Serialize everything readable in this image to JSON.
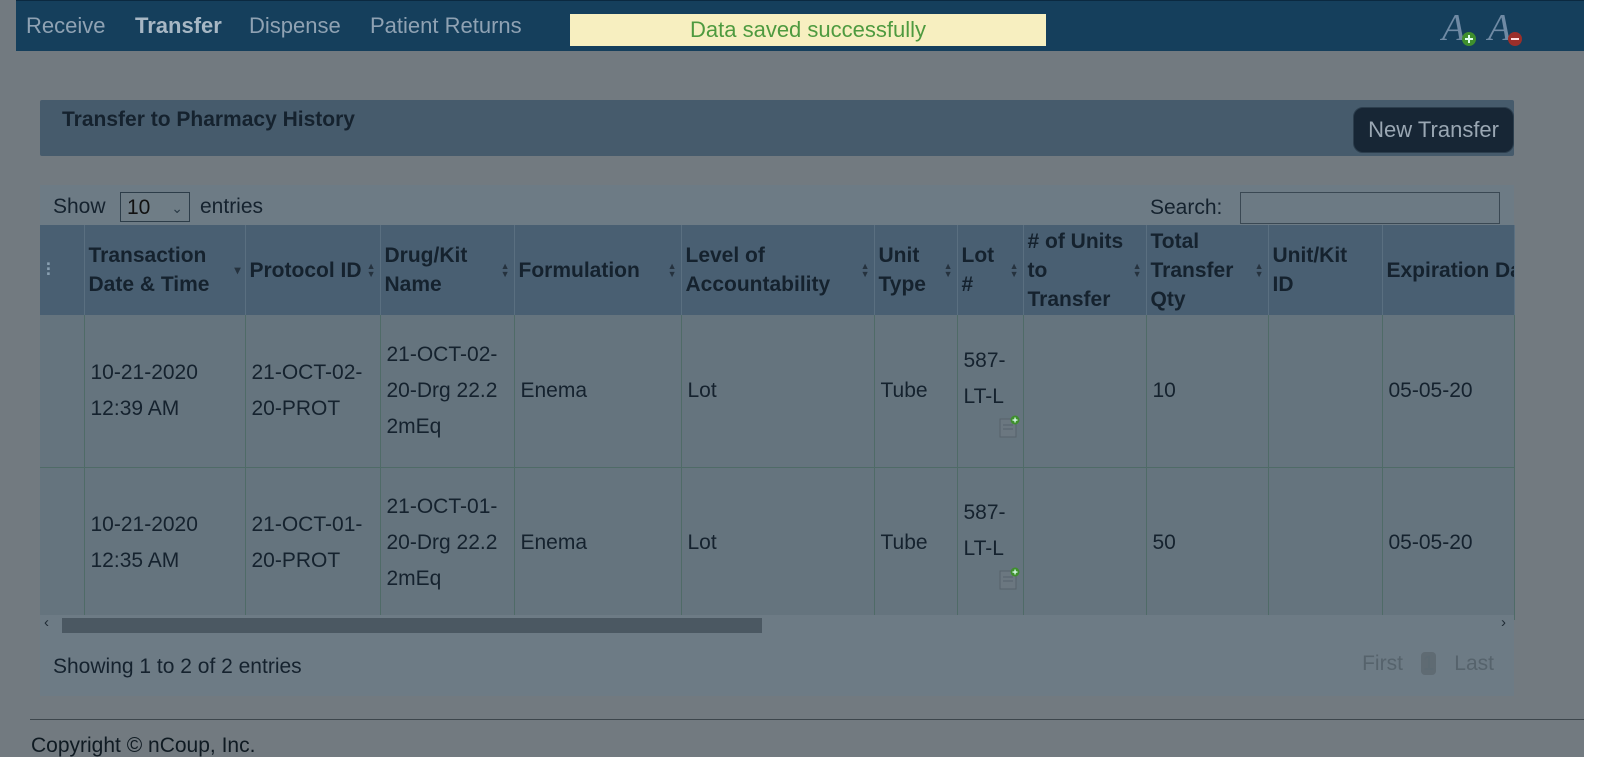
{
  "nav": {
    "items": [
      "Receive",
      "Transfer",
      "Dispense",
      "Patient Returns"
    ],
    "active": "Transfer",
    "toast": "Data saved successfully",
    "icons": [
      "font-increase-icon",
      "font-decrease-icon"
    ]
  },
  "panel": {
    "title": "Transfer to Pharmacy History",
    "new_button": "New Transfer"
  },
  "table": {
    "show_label": "Show",
    "entries_value": "10",
    "entries_label": "entries",
    "search_label": "Search:",
    "search_value": "",
    "headers": [
      "",
      "Transaction Date & Time",
      "Protocol ID",
      "Drug/Kit Name",
      "Formulation",
      "Level of Accountability",
      "Unit Type",
      "Lot #",
      "# of Units to Transfer",
      "Total Transfer Qty",
      "Unit/Kit ID",
      "Expiration Date"
    ],
    "rows": [
      {
        "datetime": "10-21-2020 12:39 AM",
        "protocol": "21-OCT-02-20-PROT",
        "drug": "21-OCT-02-20-Drg 22.22mEq",
        "formulation": "Enema",
        "level": "Lot",
        "unit_type": "Tube",
        "lot": "587-LT-L",
        "units": "",
        "total_qty": "10",
        "unit_kit_id": "",
        "expiration": "05-05-20"
      },
      {
        "datetime": "10-21-2020 12:35 AM",
        "protocol": "21-OCT-01-20-PROT",
        "drug": "21-OCT-01-20-Drg 22.22mEq",
        "formulation": "Enema",
        "level": "Lot",
        "unit_type": "Tube",
        "lot": "587-LT-L",
        "units": "",
        "total_qty": "50",
        "unit_kit_id": "",
        "expiration": "05-05-20"
      }
    ],
    "info": "Showing 1 to 2 of 2 entries",
    "pager": {
      "first": "First",
      "current": "1",
      "last": "Last"
    }
  },
  "footer": {
    "copyright": "Copyright © nCoup, Inc."
  }
}
